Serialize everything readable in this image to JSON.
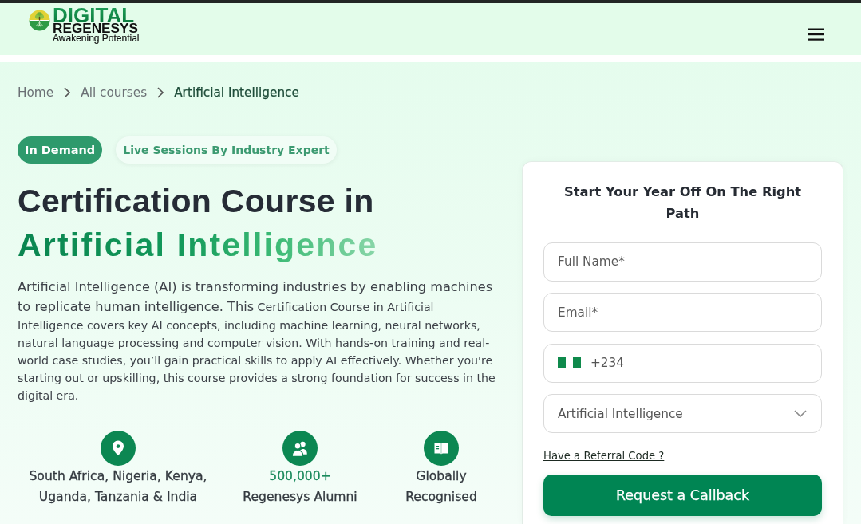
{
  "header": {
    "logo": {
      "title": "DIGITAL",
      "subtitle": "REGENESYS",
      "tagline": "Awakening Potential"
    }
  },
  "breadcrumb": [
    {
      "label": "Home",
      "current": false
    },
    {
      "label": "All courses",
      "current": false
    },
    {
      "label": "Artificial Intelligence",
      "current": true
    }
  ],
  "badges": [
    {
      "label": "In Demand",
      "kind": "filled"
    },
    {
      "label": "Live Sessions By Industry Expert",
      "kind": "soft"
    }
  ],
  "heading": {
    "text": "Certification Course in",
    "highlight": "Artificial Intelligence"
  },
  "description": {
    "lead": "Artificial Intelligence (AI) is transforming industries by enabling machines to replicate human intelligence. This",
    "body": "Certification Course in Artificial Intelligence covers key AI concepts, including machine learning, neural networks, natural language processing and computer vision. With hands-on training and real-world case studies, you’ll gain practical skills to apply AI effectively. Whether you're starting out or upskilling, this course provides a strong foundation for success in the digital era."
  },
  "features": [
    {
      "label": "South Africa, Nigeria, Kenya, Uganda, Tanzania & India"
    },
    {
      "value": "500,000+",
      "label": "Regenesys Alumni"
    },
    {
      "label": "Globally Recognised"
    }
  ],
  "form": {
    "title": "Start Your Year Off On The Right Path",
    "fields": [
      {
        "kind": "text",
        "placeholder": "Full Name*"
      },
      {
        "kind": "text",
        "placeholder": "Email*"
      },
      {
        "kind": "phone",
        "dial_code": "+234"
      },
      {
        "kind": "select",
        "value": "Artificial Intelligence"
      }
    ],
    "referral_link": "Have a Referral Code ?",
    "submit": "Request a Callback"
  }
}
